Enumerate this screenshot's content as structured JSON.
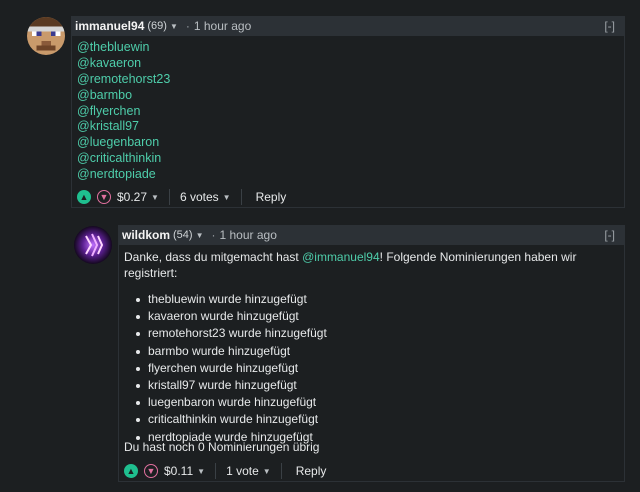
{
  "comment1": {
    "author": "immanuel94",
    "reputation": "(69)",
    "time": "1 hour ago",
    "collapse": "[-]",
    "mentions": [
      "@thebluewin",
      "@kavaeron",
      "@remotehorst23",
      "@barmbo",
      "@flyerchen",
      "@kristall97",
      "@luegenbaron",
      "@criticalthinkin",
      "@nerdtopiade"
    ],
    "payout": "$0.27",
    "votes": "6 votes",
    "reply": "Reply"
  },
  "comment2": {
    "author": "wildkom",
    "reputation": "(54)",
    "time": "1 hour ago",
    "collapse": "[-]",
    "intro_before": "Danke, dass du mitgemacht hast ",
    "intro_link": "@immanuel94",
    "intro_after": "! Folgende Nominierungen haben wir registriert:",
    "items": [
      "thebluewin wurde hinzugefügt",
      "kavaeron wurde hinzugefügt",
      "remotehorst23 wurde hinzugefügt",
      "barmbo wurde hinzugefügt",
      "flyerchen wurde hinzugefügt",
      "kristall97 wurde hinzugefügt",
      "luegenbaron wurde hinzugefügt",
      "criticalthinkin wurde hinzugefügt",
      "nerdtopiade wurde hinzugefügt"
    ],
    "outro": "Du hast noch 0 Nominierungen übrig",
    "payout": "$0.11",
    "votes": "1 vote",
    "reply": "Reply"
  },
  "colors": {
    "link": "#4ecdaa",
    "upvote": "#1fbf8f",
    "downvote": "#e0709e",
    "header_bg": "#2c3136",
    "page_bg": "#1c1f21"
  },
  "icons": {
    "upvote": "chevron-up-icon",
    "downvote": "chevron-down-icon",
    "dropdown": "caret-down-icon"
  }
}
